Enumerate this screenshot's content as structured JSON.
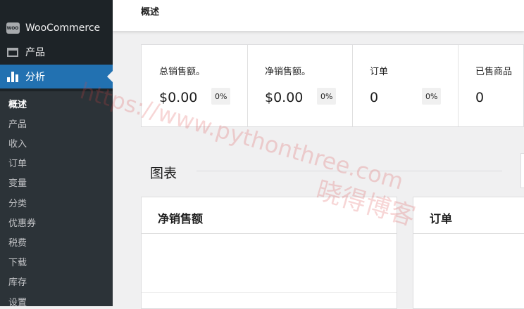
{
  "sidebar": {
    "menu": [
      {
        "label": "WooCommerce",
        "icon": "woocommerce-icon",
        "badge": "WOO"
      },
      {
        "label": "产品",
        "icon": "products-icon"
      },
      {
        "label": "分析",
        "icon": "analytics-icon",
        "active": true
      }
    ],
    "submenu": [
      {
        "label": "概述",
        "current": true
      },
      {
        "label": "产品"
      },
      {
        "label": "收入"
      },
      {
        "label": "订单"
      },
      {
        "label": "变量"
      },
      {
        "label": "分类"
      },
      {
        "label": "优惠券"
      },
      {
        "label": "税费"
      },
      {
        "label": "下载"
      },
      {
        "label": "库存"
      },
      {
        "label": "设置"
      }
    ]
  },
  "header": {
    "title": "概述"
  },
  "summary": [
    {
      "label": "总销售额。",
      "value": "$0.00",
      "delta": "0%"
    },
    {
      "label": "净销售额。",
      "value": "$0.00",
      "delta": "0%"
    },
    {
      "label": "订单",
      "value": "0",
      "delta": "0%"
    },
    {
      "label": "已售商品",
      "value": "0"
    }
  ],
  "charts": {
    "section_title": "图表",
    "panels": [
      {
        "title": "净销售额"
      },
      {
        "title": "订单"
      }
    ]
  },
  "watermark": {
    "url": "https://www.pythonthree.com",
    "name": "晓得博客"
  },
  "colors": {
    "sidebar_bg": "#1d2327",
    "submenu_bg": "#2c3338",
    "accent": "#2271b1",
    "page_bg": "#f0f0f1"
  }
}
